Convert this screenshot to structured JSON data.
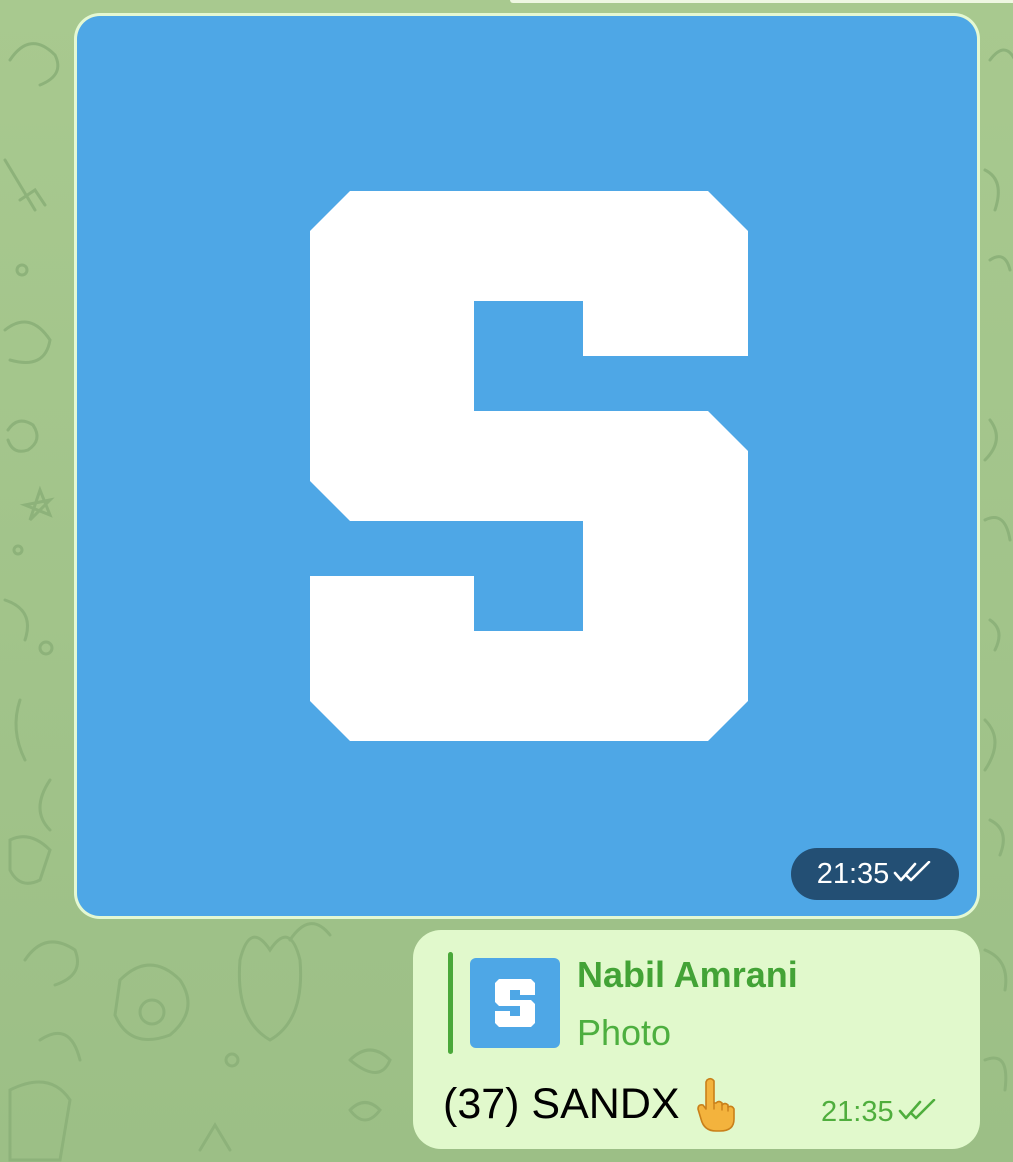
{
  "colors": {
    "wallpaper": "#9ec188",
    "bubble_outgoing": "#e1f9cc",
    "photo_background": "#4ea7e6",
    "accent_green": "#43a336"
  },
  "photo_message": {
    "logo_letter_icon": "sandbox-s-logo",
    "time": "21:35",
    "status_icon": "double-check-icon"
  },
  "reply_message": {
    "quote": {
      "sender": "Nabil Amrani",
      "type": "Photo",
      "thumbnail_icon": "sandbox-s-logo"
    },
    "text": "(37) SANDX",
    "emoji_icon": "pointing-up-hand-icon",
    "time": "21:35",
    "status_icon": "double-check-icon"
  }
}
